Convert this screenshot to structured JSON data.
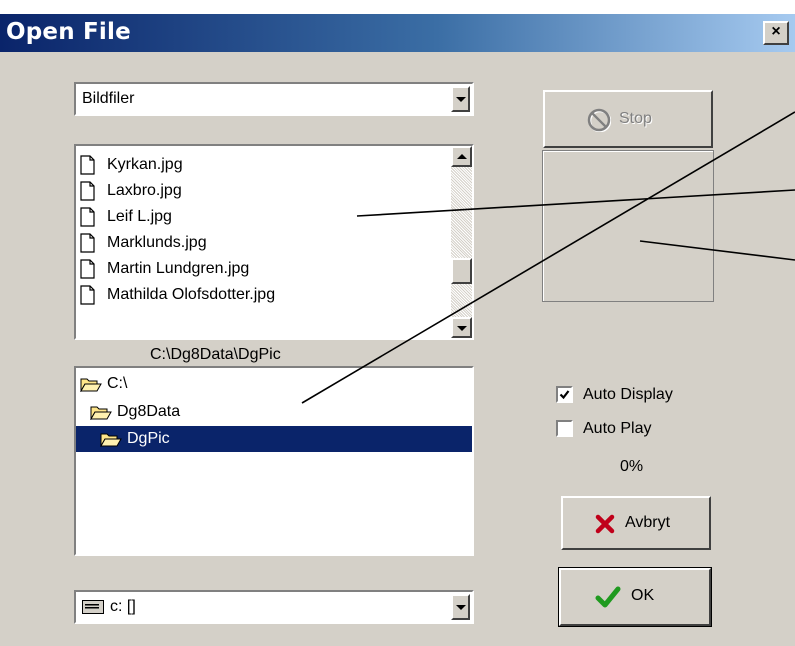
{
  "window": {
    "title": "Open File",
    "close_glyph": "×"
  },
  "filter_combo": {
    "value": "Bildfiler"
  },
  "file_list": {
    "items": [
      "Kyrkan.jpg",
      "Laxbro.jpg",
      "Leif L.jpg",
      "Marklunds.jpg",
      "Martin Lundgren.jpg",
      "Mathilda Olofsdotter.jpg"
    ]
  },
  "current_path": "C:\\Dg8Data\\DgPic",
  "folder_tree": {
    "items": [
      {
        "label": "C:\\",
        "icon": "open-folder-icon",
        "selected": false
      },
      {
        "label": "Dg8Data",
        "icon": "open-folder-icon",
        "selected": false
      },
      {
        "label": "DgPic",
        "icon": "open-folder-icon",
        "selected": true
      }
    ]
  },
  "drive_combo": {
    "value": "c: []",
    "icon": "drive-icon"
  },
  "stop_button": {
    "label": "Stop",
    "icon": "stop-icon",
    "enabled": false
  },
  "options": {
    "auto_display": {
      "label": "Auto Display",
      "checked": true
    },
    "auto_play": {
      "label": "Auto Play",
      "checked": false
    }
  },
  "progress": {
    "text": "0%"
  },
  "cancel_button": {
    "label": "Avbryt",
    "icon": "x-icon"
  },
  "ok_button": {
    "label": "OK",
    "icon": "checkmark-icon"
  },
  "colors": {
    "title_start": "#0a246a",
    "title_end": "#a6caf0",
    "face": "#d4d0c8",
    "selection": "#0a246a"
  }
}
